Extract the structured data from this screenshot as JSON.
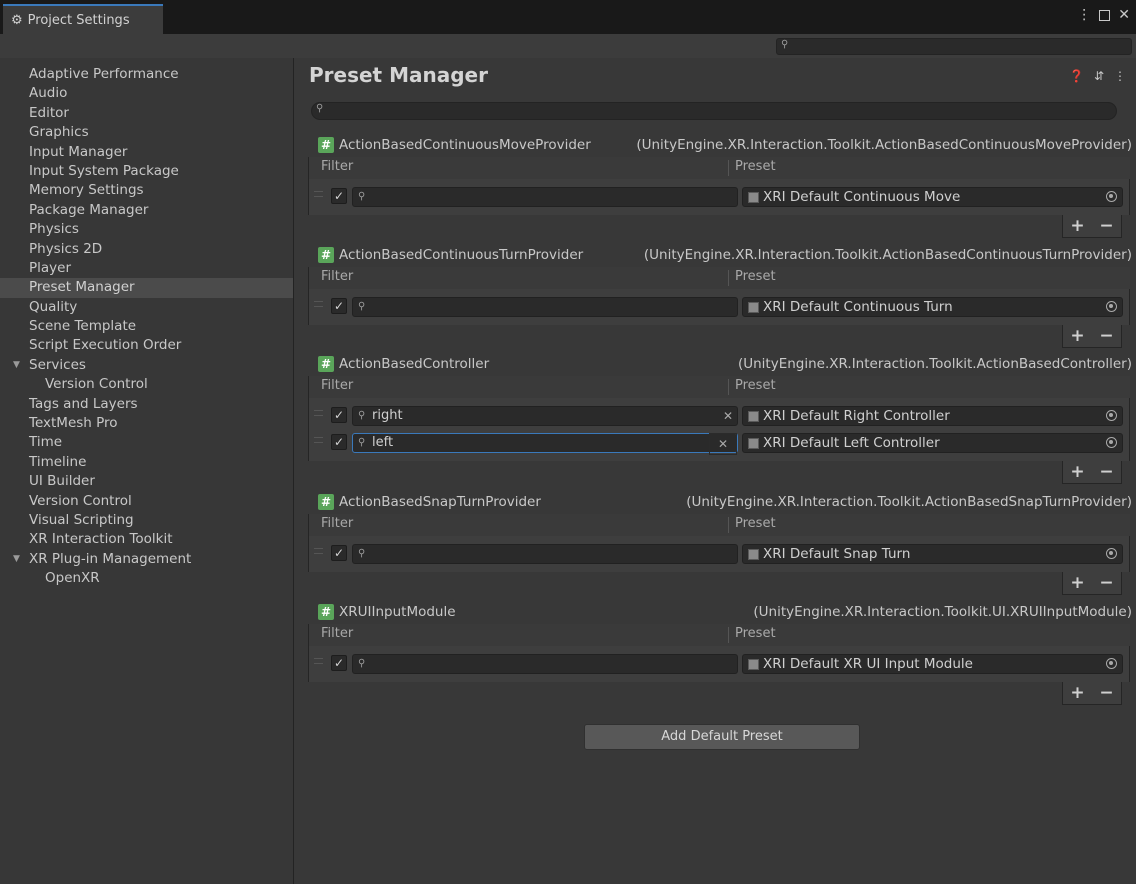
{
  "window": {
    "tab_title": "Project Settings",
    "controls": [
      "⋮",
      "□",
      "✕"
    ]
  },
  "sidebar": {
    "items": [
      {
        "label": "Adaptive Performance"
      },
      {
        "label": "Audio"
      },
      {
        "label": "Editor"
      },
      {
        "label": "Graphics"
      },
      {
        "label": "Input Manager"
      },
      {
        "label": "Input System Package"
      },
      {
        "label": "Memory Settings"
      },
      {
        "label": "Package Manager"
      },
      {
        "label": "Physics"
      },
      {
        "label": "Physics 2D"
      },
      {
        "label": "Player"
      },
      {
        "label": "Preset Manager",
        "selected": true
      },
      {
        "label": "Quality"
      },
      {
        "label": "Scene Template"
      },
      {
        "label": "Script Execution Order"
      },
      {
        "label": "Services",
        "expanded": true
      },
      {
        "label": "Version Control",
        "indent": true
      },
      {
        "label": "Tags and Layers"
      },
      {
        "label": "TextMesh Pro"
      },
      {
        "label": "Time"
      },
      {
        "label": "Timeline"
      },
      {
        "label": "UI Builder"
      },
      {
        "label": "Version Control"
      },
      {
        "label": "Visual Scripting"
      },
      {
        "label": "XR Interaction Toolkit"
      },
      {
        "label": "XR Plug-in Management",
        "expanded": true
      },
      {
        "label": "OpenXR",
        "indent": true
      }
    ]
  },
  "main": {
    "title": "Preset Manager",
    "filter_header": "Filter",
    "preset_header": "Preset",
    "groups": [
      {
        "name": "ActionBasedContinuousMoveProvider",
        "full_type": "(UnityEngine.XR.Interaction.Toolkit.ActionBasedContinuousMoveProvider)",
        "rows": [
          {
            "filter": "",
            "preset": "XRI Default Continuous Move"
          }
        ]
      },
      {
        "name": "ActionBasedContinuousTurnProvider",
        "full_type": "(UnityEngine.XR.Interaction.Toolkit.ActionBasedContinuousTurnProvider)",
        "rows": [
          {
            "filter": "",
            "preset": "XRI Default Continuous Turn"
          }
        ]
      },
      {
        "name": "ActionBasedController",
        "full_type": "(UnityEngine.XR.Interaction.Toolkit.ActionBasedController)",
        "rows": [
          {
            "filter": "right",
            "preset": "XRI Default Right Controller"
          },
          {
            "filter": "left",
            "preset": "XRI Default Left Controller",
            "focused": true
          }
        ]
      },
      {
        "name": "ActionBasedSnapTurnProvider",
        "full_type": "(UnityEngine.XR.Interaction.Toolkit.ActionBasedSnapTurnProvider)",
        "rows": [
          {
            "filter": "",
            "preset": "XRI Default Snap Turn"
          }
        ]
      },
      {
        "name": "XRUIInputModule",
        "full_type": "(UnityEngine.XR.Interaction.Toolkit.UI.XRUIInputModule)",
        "rows": [
          {
            "filter": "",
            "preset": "XRI Default XR UI Input Module"
          }
        ]
      }
    ],
    "add_default_label": "Add Default Preset"
  }
}
